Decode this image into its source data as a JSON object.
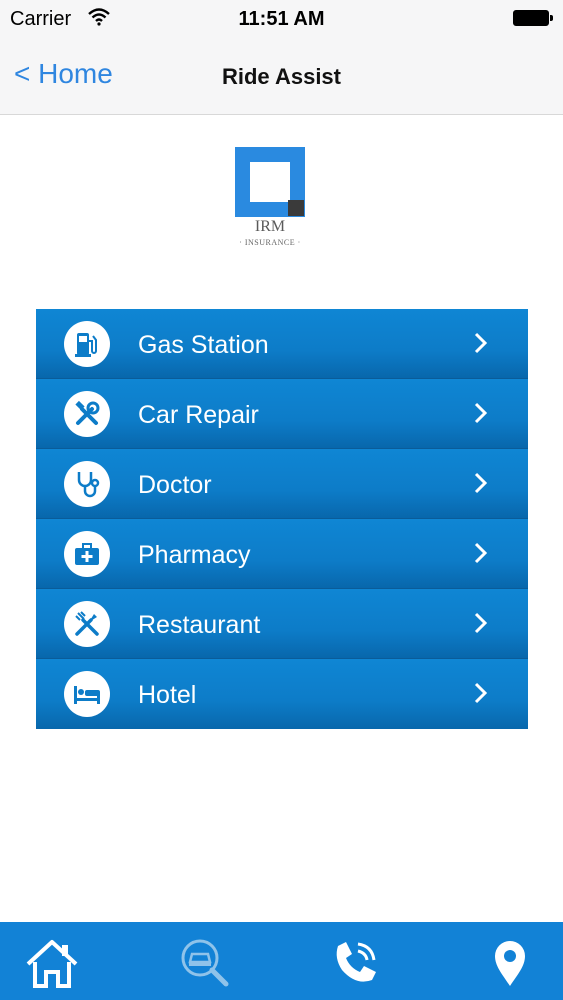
{
  "status": {
    "carrier": "Carrier",
    "time": "11:51 AM"
  },
  "nav": {
    "back_label": "< Home",
    "title": "Ride Assist"
  },
  "logo": {
    "name": "IRM",
    "sub": "· INSURANCE ·"
  },
  "menu": [
    {
      "label": "Gas Station",
      "icon": "gas-pump-icon"
    },
    {
      "label": "Car Repair",
      "icon": "tools-icon"
    },
    {
      "label": "Doctor",
      "icon": "stethoscope-icon"
    },
    {
      "label": "Pharmacy",
      "icon": "medical-kit-icon"
    },
    {
      "label": "Restaurant",
      "icon": "fork-knife-icon"
    },
    {
      "label": "Hotel",
      "icon": "bed-icon"
    }
  ],
  "tabs": [
    {
      "icon": "home-icon",
      "active": true
    },
    {
      "icon": "car-search-icon",
      "active": false
    },
    {
      "icon": "phone-icon",
      "active": false
    },
    {
      "icon": "map-pin-icon",
      "active": false
    }
  ],
  "colors": {
    "accent": "#2f86e0",
    "menu_blue": "#0d7cc8",
    "tab_bar": "#1282d6"
  }
}
